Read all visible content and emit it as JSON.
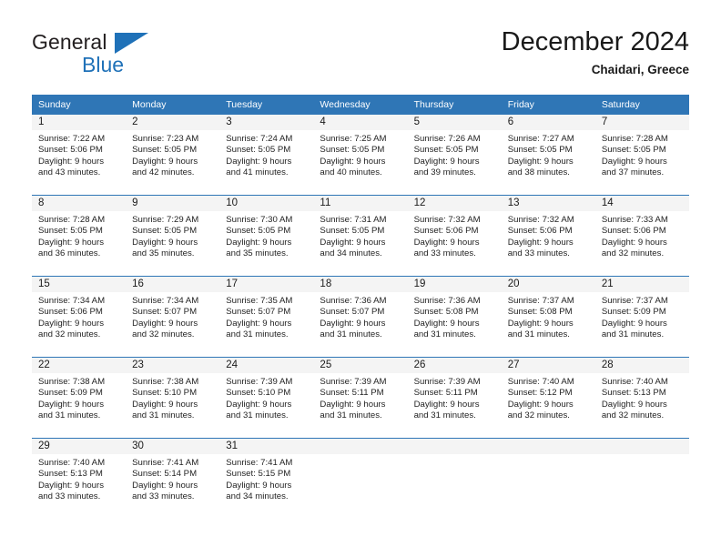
{
  "brand": {
    "name_top": "General",
    "name_bottom": "Blue",
    "triangle_color": "#1f71b8",
    "text_color": "#231f20"
  },
  "header": {
    "title": "December 2024",
    "subtitle": "Chaidari, Greece"
  },
  "theme": {
    "header_blue": "#2f76b6",
    "daynum_band": "#f4f4f4",
    "separator": "#2f76b6"
  },
  "calendar": {
    "weekday_headers": [
      "Sunday",
      "Monday",
      "Tuesday",
      "Wednesday",
      "Thursday",
      "Friday",
      "Saturday"
    ],
    "weeks": [
      [
        {
          "day": "1",
          "sunrise": "Sunrise: 7:22 AM",
          "sunset": "Sunset: 5:06 PM",
          "daylight_line1": "Daylight: 9 hours",
          "daylight_line2": "and 43 minutes."
        },
        {
          "day": "2",
          "sunrise": "Sunrise: 7:23 AM",
          "sunset": "Sunset: 5:05 PM",
          "daylight_line1": "Daylight: 9 hours",
          "daylight_line2": "and 42 minutes."
        },
        {
          "day": "3",
          "sunrise": "Sunrise: 7:24 AM",
          "sunset": "Sunset: 5:05 PM",
          "daylight_line1": "Daylight: 9 hours",
          "daylight_line2": "and 41 minutes."
        },
        {
          "day": "4",
          "sunrise": "Sunrise: 7:25 AM",
          "sunset": "Sunset: 5:05 PM",
          "daylight_line1": "Daylight: 9 hours",
          "daylight_line2": "and 40 minutes."
        },
        {
          "day": "5",
          "sunrise": "Sunrise: 7:26 AM",
          "sunset": "Sunset: 5:05 PM",
          "daylight_line1": "Daylight: 9 hours",
          "daylight_line2": "and 39 minutes."
        },
        {
          "day": "6",
          "sunrise": "Sunrise: 7:27 AM",
          "sunset": "Sunset: 5:05 PM",
          "daylight_line1": "Daylight: 9 hours",
          "daylight_line2": "and 38 minutes."
        },
        {
          "day": "7",
          "sunrise": "Sunrise: 7:28 AM",
          "sunset": "Sunset: 5:05 PM",
          "daylight_line1": "Daylight: 9 hours",
          "daylight_line2": "and 37 minutes."
        }
      ],
      [
        {
          "day": "8",
          "sunrise": "Sunrise: 7:28 AM",
          "sunset": "Sunset: 5:05 PM",
          "daylight_line1": "Daylight: 9 hours",
          "daylight_line2": "and 36 minutes."
        },
        {
          "day": "9",
          "sunrise": "Sunrise: 7:29 AM",
          "sunset": "Sunset: 5:05 PM",
          "daylight_line1": "Daylight: 9 hours",
          "daylight_line2": "and 35 minutes."
        },
        {
          "day": "10",
          "sunrise": "Sunrise: 7:30 AM",
          "sunset": "Sunset: 5:05 PM",
          "daylight_line1": "Daylight: 9 hours",
          "daylight_line2": "and 35 minutes."
        },
        {
          "day": "11",
          "sunrise": "Sunrise: 7:31 AM",
          "sunset": "Sunset: 5:05 PM",
          "daylight_line1": "Daylight: 9 hours",
          "daylight_line2": "and 34 minutes."
        },
        {
          "day": "12",
          "sunrise": "Sunrise: 7:32 AM",
          "sunset": "Sunset: 5:06 PM",
          "daylight_line1": "Daylight: 9 hours",
          "daylight_line2": "and 33 minutes."
        },
        {
          "day": "13",
          "sunrise": "Sunrise: 7:32 AM",
          "sunset": "Sunset: 5:06 PM",
          "daylight_line1": "Daylight: 9 hours",
          "daylight_line2": "and 33 minutes."
        },
        {
          "day": "14",
          "sunrise": "Sunrise: 7:33 AM",
          "sunset": "Sunset: 5:06 PM",
          "daylight_line1": "Daylight: 9 hours",
          "daylight_line2": "and 32 minutes."
        }
      ],
      [
        {
          "day": "15",
          "sunrise": "Sunrise: 7:34 AM",
          "sunset": "Sunset: 5:06 PM",
          "daylight_line1": "Daylight: 9 hours",
          "daylight_line2": "and 32 minutes."
        },
        {
          "day": "16",
          "sunrise": "Sunrise: 7:34 AM",
          "sunset": "Sunset: 5:07 PM",
          "daylight_line1": "Daylight: 9 hours",
          "daylight_line2": "and 32 minutes."
        },
        {
          "day": "17",
          "sunrise": "Sunrise: 7:35 AM",
          "sunset": "Sunset: 5:07 PM",
          "daylight_line1": "Daylight: 9 hours",
          "daylight_line2": "and 31 minutes."
        },
        {
          "day": "18",
          "sunrise": "Sunrise: 7:36 AM",
          "sunset": "Sunset: 5:07 PM",
          "daylight_line1": "Daylight: 9 hours",
          "daylight_line2": "and 31 minutes."
        },
        {
          "day": "19",
          "sunrise": "Sunrise: 7:36 AM",
          "sunset": "Sunset: 5:08 PM",
          "daylight_line1": "Daylight: 9 hours",
          "daylight_line2": "and 31 minutes."
        },
        {
          "day": "20",
          "sunrise": "Sunrise: 7:37 AM",
          "sunset": "Sunset: 5:08 PM",
          "daylight_line1": "Daylight: 9 hours",
          "daylight_line2": "and 31 minutes."
        },
        {
          "day": "21",
          "sunrise": "Sunrise: 7:37 AM",
          "sunset": "Sunset: 5:09 PM",
          "daylight_line1": "Daylight: 9 hours",
          "daylight_line2": "and 31 minutes."
        }
      ],
      [
        {
          "day": "22",
          "sunrise": "Sunrise: 7:38 AM",
          "sunset": "Sunset: 5:09 PM",
          "daylight_line1": "Daylight: 9 hours",
          "daylight_line2": "and 31 minutes."
        },
        {
          "day": "23",
          "sunrise": "Sunrise: 7:38 AM",
          "sunset": "Sunset: 5:10 PM",
          "daylight_line1": "Daylight: 9 hours",
          "daylight_line2": "and 31 minutes."
        },
        {
          "day": "24",
          "sunrise": "Sunrise: 7:39 AM",
          "sunset": "Sunset: 5:10 PM",
          "daylight_line1": "Daylight: 9 hours",
          "daylight_line2": "and 31 minutes."
        },
        {
          "day": "25",
          "sunrise": "Sunrise: 7:39 AM",
          "sunset": "Sunset: 5:11 PM",
          "daylight_line1": "Daylight: 9 hours",
          "daylight_line2": "and 31 minutes."
        },
        {
          "day": "26",
          "sunrise": "Sunrise: 7:39 AM",
          "sunset": "Sunset: 5:11 PM",
          "daylight_line1": "Daylight: 9 hours",
          "daylight_line2": "and 31 minutes."
        },
        {
          "day": "27",
          "sunrise": "Sunrise: 7:40 AM",
          "sunset": "Sunset: 5:12 PM",
          "daylight_line1": "Daylight: 9 hours",
          "daylight_line2": "and 32 minutes."
        },
        {
          "day": "28",
          "sunrise": "Sunrise: 7:40 AM",
          "sunset": "Sunset: 5:13 PM",
          "daylight_line1": "Daylight: 9 hours",
          "daylight_line2": "and 32 minutes."
        }
      ],
      [
        {
          "day": "29",
          "sunrise": "Sunrise: 7:40 AM",
          "sunset": "Sunset: 5:13 PM",
          "daylight_line1": "Daylight: 9 hours",
          "daylight_line2": "and 33 minutes."
        },
        {
          "day": "30",
          "sunrise": "Sunrise: 7:41 AM",
          "sunset": "Sunset: 5:14 PM",
          "daylight_line1": "Daylight: 9 hours",
          "daylight_line2": "and 33 minutes."
        },
        {
          "day": "31",
          "sunrise": "Sunrise: 7:41 AM",
          "sunset": "Sunset: 5:15 PM",
          "daylight_line1": "Daylight: 9 hours",
          "daylight_line2": "and 34 minutes."
        },
        {
          "day": "",
          "sunrise": "",
          "sunset": "",
          "daylight_line1": "",
          "daylight_line2": ""
        },
        {
          "day": "",
          "sunrise": "",
          "sunset": "",
          "daylight_line1": "",
          "daylight_line2": ""
        },
        {
          "day": "",
          "sunrise": "",
          "sunset": "",
          "daylight_line1": "",
          "daylight_line2": ""
        },
        {
          "day": "",
          "sunrise": "",
          "sunset": "",
          "daylight_line1": "",
          "daylight_line2": ""
        }
      ]
    ]
  }
}
